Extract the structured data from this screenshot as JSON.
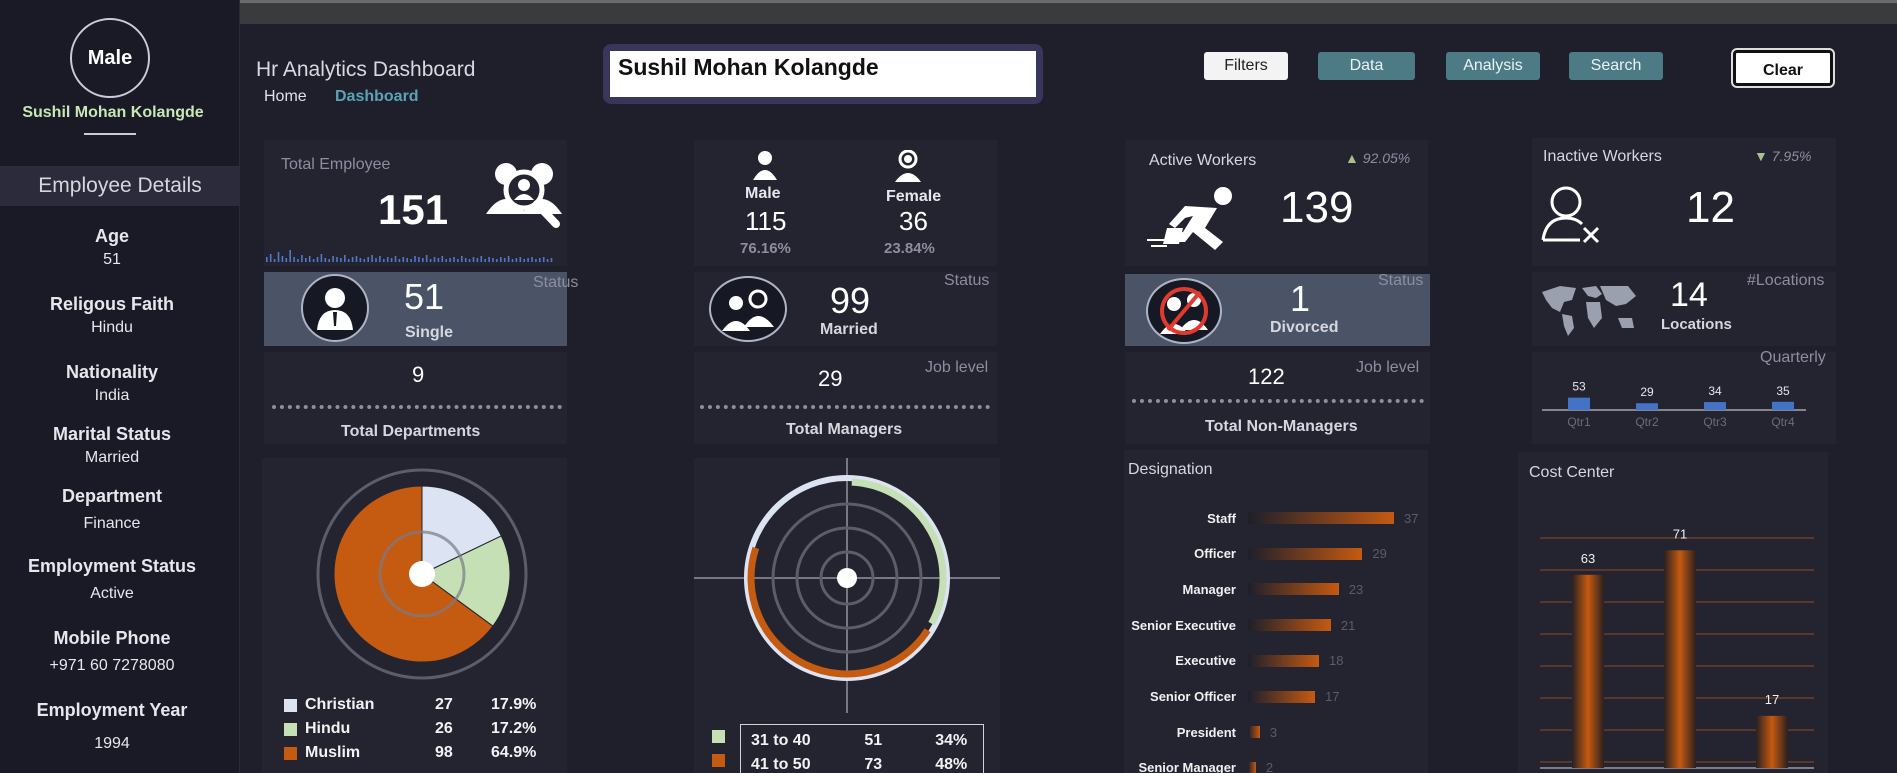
{
  "sidebar": {
    "gender": "Male",
    "employee_name": "Sushil Mohan Kolangde",
    "section_title": "Employee Details",
    "fields": [
      {
        "label": "Age",
        "value": "51"
      },
      {
        "label": "Religous Faith",
        "value": "Hindu"
      },
      {
        "label": "Nationality",
        "value": "India"
      },
      {
        "label": "Marital Status",
        "value": "Married"
      },
      {
        "label": "Department",
        "value": "Finance"
      },
      {
        "label": "Employment Status",
        "value": "Active"
      },
      {
        "label": "Mobile Phone",
        "value": "+971 60 7278080"
      },
      {
        "label": "Employment Year",
        "value": "1994"
      }
    ]
  },
  "header": {
    "title": "Hr Analytics Dashboard",
    "breadcrumb_home": "Home",
    "breadcrumb_current": "Dashboard",
    "name_input_value": "Sushil Mohan Kolangde",
    "buttons": {
      "filters": "Filters",
      "data": "Data",
      "analysis": "Analysis",
      "search": "Search",
      "clear": "Clear"
    }
  },
  "total_employee": {
    "label": "Total Employee",
    "value": "151"
  },
  "gender": {
    "male_label": "Male",
    "male_value": "115",
    "male_pct": "76.16%",
    "female_label": "Female",
    "female_value": "36",
    "female_pct": "23.84%"
  },
  "active": {
    "label": "Active Workers",
    "value": "139",
    "pct": "92.05%"
  },
  "inactive": {
    "label": "Inactive Workers",
    "value": "12",
    "pct": "7.95%"
  },
  "status_single": {
    "tag": "Status",
    "value": "51",
    "label": "Single"
  },
  "status_married": {
    "tag": "Status",
    "value": "99",
    "label": "Married"
  },
  "status_divorced": {
    "tag": "Status",
    "value": "1",
    "label": "Divorced"
  },
  "locations": {
    "tag": "#Locations",
    "value": "14",
    "label": "Locations"
  },
  "departments": {
    "value": "9",
    "label": "Total Departments"
  },
  "managers": {
    "tag": "Job level",
    "value": "29",
    "label": "Total Managers"
  },
  "non_managers": {
    "tag": "Job level",
    "value": "122",
    "label": "Total Non-Managers"
  },
  "quarterly": {
    "tag": "Quarterly",
    "categories": [
      "Qtr1",
      "Qtr2",
      "Qtr3",
      "Qtr4"
    ],
    "values": [
      53,
      29,
      34,
      35
    ]
  },
  "religion_legend": [
    {
      "name": "Christian",
      "count": "27",
      "pct": "17.9%",
      "color": "#dce3f2"
    },
    {
      "name": "Hindu",
      "count": "26",
      "pct": "17.2%",
      "color": "#c5e0b4"
    },
    {
      "name": "Muslim",
      "count": "98",
      "pct": "64.9%",
      "color": "#c55a11"
    }
  ],
  "age_legend": [
    {
      "name": "31 to 40",
      "count": "51",
      "pct": "34%",
      "color": "#c5e0b4"
    },
    {
      "name": "41 to 50",
      "count": "73",
      "pct": "48%",
      "color": "#c55a11"
    }
  ],
  "designation": {
    "title": "Designation"
  },
  "cost_center": {
    "title": "Cost Center"
  },
  "chart_data": [
    {
      "type": "pie",
      "title": "",
      "categories": [
        "Christian",
        "Hindu",
        "Muslim"
      ],
      "values": [
        27,
        26,
        98
      ],
      "colors": [
        "#dce3f2",
        "#c5e0b4",
        "#c55a11"
      ]
    },
    {
      "type": "pie",
      "title": "",
      "categories": [
        "31 to 40",
        "41 to 50"
      ],
      "values": [
        51,
        73
      ],
      "colors": [
        "#c5e0b4",
        "#c55a11"
      ]
    },
    {
      "type": "bar",
      "title": "Quarterly",
      "categories": [
        "Qtr1",
        "Qtr2",
        "Qtr3",
        "Qtr4"
      ],
      "values": [
        53,
        29,
        34,
        35
      ],
      "colors": [
        "#4472c4"
      ]
    },
    {
      "type": "bar",
      "title": "Designation",
      "orientation": "horizontal",
      "categories": [
        "Staff",
        "Officer",
        "Manager",
        "Senior Executive",
        "Executive",
        "Senior Officer",
        "President",
        "Senior Manager"
      ],
      "values": [
        37,
        29,
        23,
        21,
        18,
        17,
        3,
        2
      ],
      "colors": [
        "#c55a11"
      ]
    },
    {
      "type": "bar",
      "title": "Cost Center",
      "values": [
        63,
        71,
        17
      ],
      "colors": [
        "#c55a11"
      ],
      "grid": true
    }
  ]
}
